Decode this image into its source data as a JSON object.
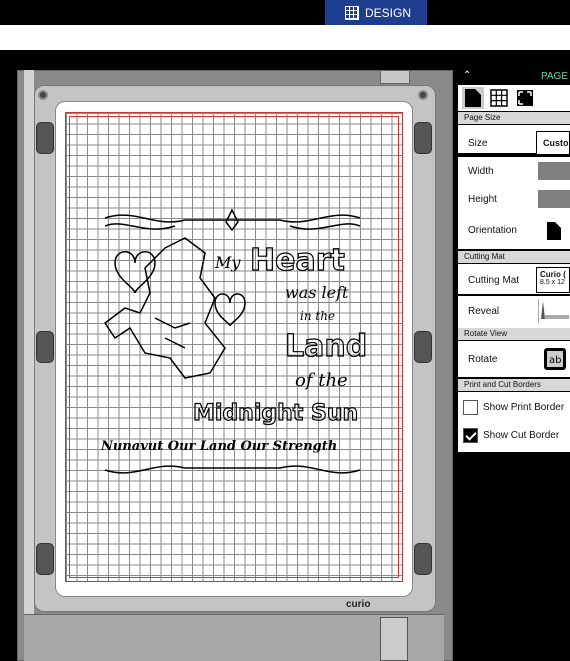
{
  "top": {
    "design_tab": "DESIGN"
  },
  "panel": {
    "title": "PAGE",
    "sections": {
      "page_size": "Page Size",
      "cutting_mat": "Cutting Mat",
      "rotate_view": "Rotate View",
      "print_cut": "Print and Cut Borders"
    },
    "labels": {
      "size": "Size",
      "size_value": "Custo",
      "width": "Width",
      "height": "Height",
      "orientation": "Orientation",
      "cutting_mat": "Cutting Mat",
      "mat_value_line1": "Curio (",
      "mat_value_line2": "8.5 x 12",
      "reveal": "Reveal",
      "rotate": "Rotate",
      "show_print_border": "Show Print Border",
      "show_cut_border": "Show Cut Border"
    },
    "checks": {
      "show_print_border": false,
      "show_cut_border": true
    }
  },
  "canvas": {
    "brand": "curio",
    "artwork_text": [
      "My",
      "Heart",
      "was left",
      "in the",
      "Land",
      "of the",
      "Midnight Sun",
      "Nunavut Our Land Our Strength"
    ]
  },
  "colors": {
    "accent": "#1d3d8f",
    "panel_title": "#6fd3a9",
    "cut_border": "#cc3333"
  }
}
